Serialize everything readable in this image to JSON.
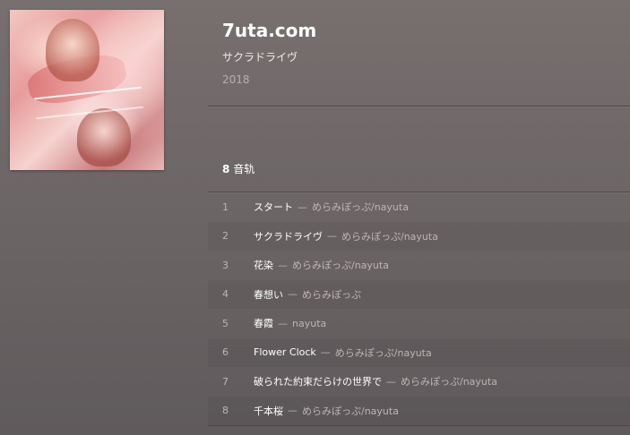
{
  "album": {
    "title": "7uta.com",
    "name": "サクラドライヴ",
    "year": "2018",
    "cover_alt": "album-cover"
  },
  "track_count": {
    "number": "8",
    "label": "音轨"
  },
  "separator": "—",
  "tracks": [
    {
      "num": "1",
      "name": "スタート",
      "artist": "めらみぽっぷ/nayuta"
    },
    {
      "num": "2",
      "name": "サクラドライヴ",
      "artist": "めらみぽっぷ/nayuta"
    },
    {
      "num": "3",
      "name": "花染",
      "artist": "めらみぽっぷ/nayuta"
    },
    {
      "num": "4",
      "name": "春想い",
      "artist": "めらみぽっぷ"
    },
    {
      "num": "5",
      "name": "春霞",
      "artist": "nayuta"
    },
    {
      "num": "6",
      "name": "Flower Clock",
      "artist": "めらみぽっぷ/nayuta"
    },
    {
      "num": "7",
      "name": "破られた約束だらけの世界で",
      "artist": "めらみぽっぷ/nayuta"
    },
    {
      "num": "8",
      "name": "千本桜",
      "artist": "めらみぽっぷ/nayuta"
    }
  ]
}
